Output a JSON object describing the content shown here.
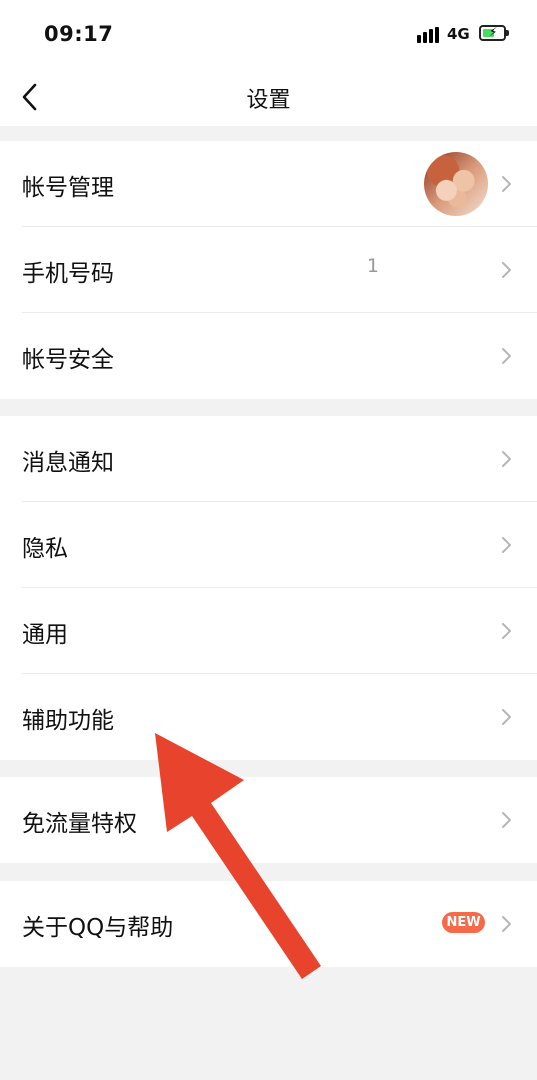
{
  "status_bar": {
    "time": "09:17",
    "network": "4G"
  },
  "header": {
    "title": "设置"
  },
  "groups": [
    {
      "items": [
        {
          "label": "帐号管理"
        },
        {
          "label": "手机号码",
          "value": "1"
        },
        {
          "label": "帐号安全"
        }
      ]
    },
    {
      "items": [
        {
          "label": "消息通知"
        },
        {
          "label": "隐私"
        },
        {
          "label": "通用"
        },
        {
          "label": "辅助功能"
        }
      ]
    },
    {
      "items": [
        {
          "label": "免流量特权"
        }
      ]
    },
    {
      "items": [
        {
          "label": "关于QQ与帮助",
          "badge": "NEW"
        }
      ]
    }
  ],
  "colors": {
    "background": "#f2f2f2",
    "badge": "#f56a48",
    "annotation_arrow": "#e8432c"
  },
  "icons": [
    "back-chevron-icon",
    "chevron-right-icon",
    "signal-icon",
    "battery-charging-icon"
  ]
}
